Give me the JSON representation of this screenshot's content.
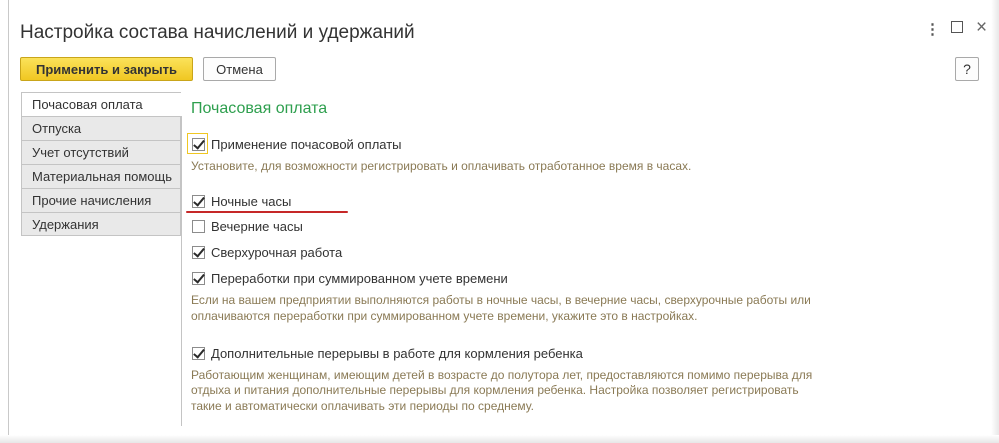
{
  "window": {
    "title": "Настройка состава начислений и удержаний"
  },
  "toolbar": {
    "apply_close_label": "Применить и закрыть",
    "cancel_label": "Отмена",
    "help_label": "?"
  },
  "tabs": [
    {
      "label": "Почасовая оплата",
      "active": true
    },
    {
      "label": "Отпуска"
    },
    {
      "label": "Учет отсутствий"
    },
    {
      "label": "Материальная помощь"
    },
    {
      "label": "Прочие начисления"
    },
    {
      "label": "Удержания"
    }
  ],
  "main": {
    "section_title": "Почасовая оплата",
    "options": [
      {
        "label": "Применение почасовой оплаты",
        "checked": true
      },
      {
        "label": "Ночные часы",
        "checked": true
      },
      {
        "label": "Вечерние часы",
        "checked": false
      },
      {
        "label": "Сверхурочная работа",
        "checked": true
      },
      {
        "label": "Переработки при суммированном учете времени",
        "checked": true
      },
      {
        "label": "Дополнительные перерывы в работе для кормления ребенка",
        "checked": true
      }
    ],
    "desc_hourly": "Установите, для возможности регистрировать и оплачивать отработанное время в часах.",
    "desc_overtime_1": "Если на вашем предприятии выполняются работы в ночные часы, в вечерние часы, сверхурочные работы или",
    "desc_overtime_2": "оплачиваются переработки при суммированном учете времени, укажите это в настройках.",
    "desc_feeding_1": "Работающим женщинам, имеющим детей в возрасте до полутора лет, предоставляются помимо перерыва для",
    "desc_feeding_2": "отдыха и питания дополнительные перерывы для кормления ребенка. Настройка позволяет регистрировать",
    "desc_feeding_3": "такие и автоматически оплачивать эти периоды по среднему."
  }
}
